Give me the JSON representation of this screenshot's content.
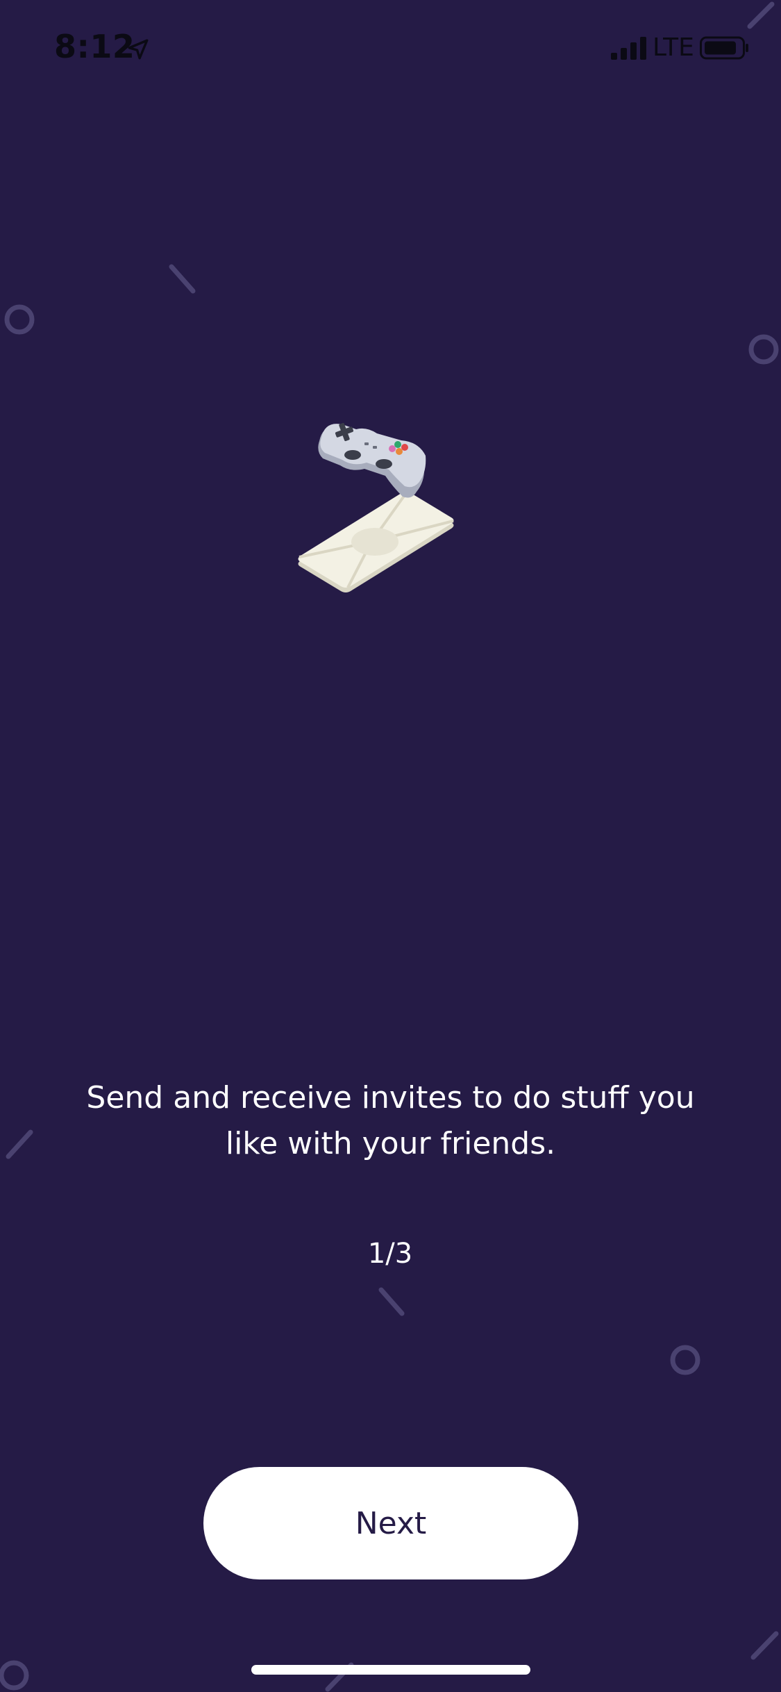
{
  "status_bar": {
    "time": "8:12",
    "network": "LTE"
  },
  "onboarding": {
    "message": "Send and receive invites to do stuff you like with your friends.",
    "page_indicator": "1/3",
    "next_label": "Next"
  },
  "colors": {
    "background": "#251B46",
    "decoration": "#4A4270",
    "button_bg": "#FFFFFF",
    "button_text": "#251B46"
  },
  "icons": {
    "illustration": "gamepad-and-envelope",
    "location": "location-arrow-icon",
    "signal": "signal-bars-icon",
    "battery": "battery-icon"
  }
}
